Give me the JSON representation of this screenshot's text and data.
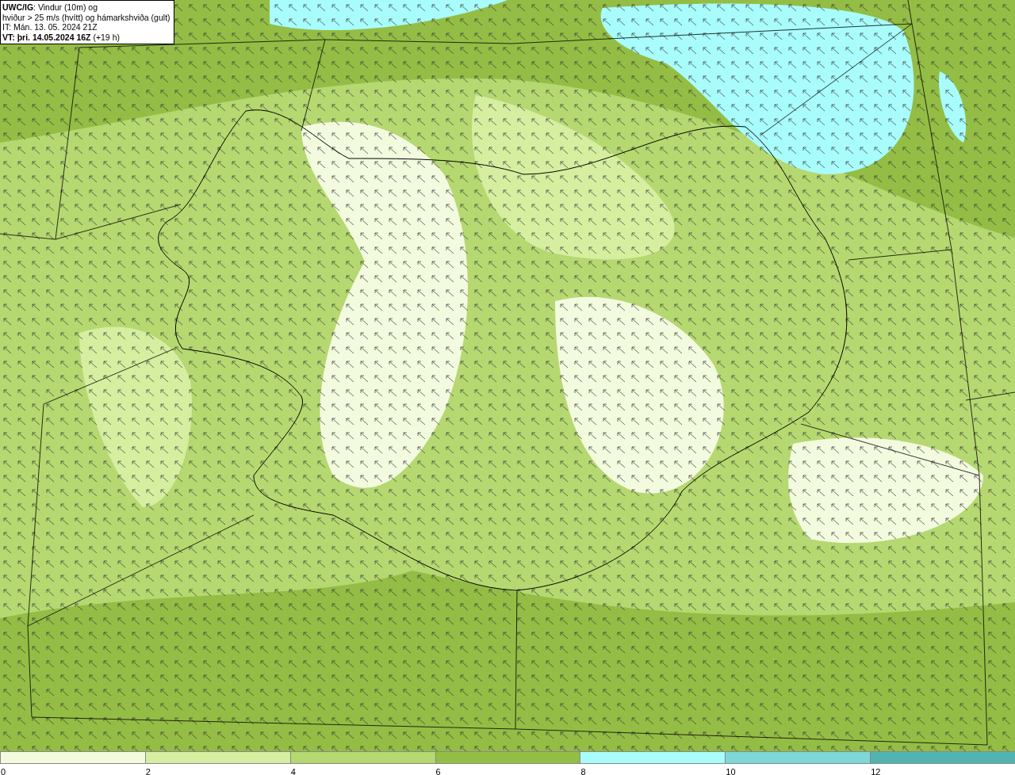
{
  "info_box": {
    "lines": [
      "**UWC/IG**: Vindur (10m) og",
      "hviður > 25 m/s (hvítt) og hámarkshviða (gult)",
      "IT: Mán. 13. 05. 2024 21Z",
      "**VT: þri. 14.05.2024 16Z** (+19 h)"
    ]
  },
  "legend": {
    "segments": [
      {
        "color": "#f3fbdf"
      },
      {
        "color": "#d6eea0"
      },
      {
        "color": "#b5d870"
      },
      {
        "color": "#93bd45"
      },
      {
        "color": "#a8fcfc"
      },
      {
        "color": "#7ed8d8"
      },
      {
        "color": "#52b3b3"
      }
    ],
    "labels": [
      "0",
      "2",
      "4",
      "6",
      "8",
      "10",
      "12"
    ]
  }
}
